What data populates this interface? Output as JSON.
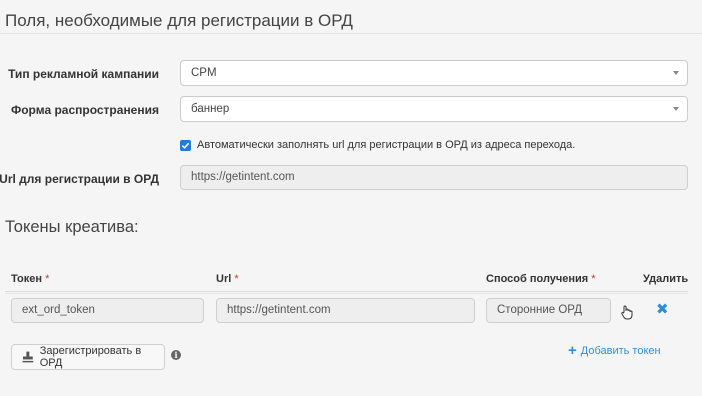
{
  "section": {
    "title": "Поля, необходимые для регистрации в ОРД"
  },
  "fields": {
    "campaign_type": {
      "label": "Тип рекламной кампании",
      "value": "CPM"
    },
    "distribution_form": {
      "label": "Форма распространения",
      "value": "баннер"
    },
    "auto_url": {
      "label": "Автоматически заполнять url для регистрации в ОРД из адреса перехода.",
      "checked": true
    },
    "ord_url": {
      "label": "Url для регистрации в ОРД",
      "value": "https://getintent.com"
    }
  },
  "tokens": {
    "title": "Токены креатива:",
    "columns": {
      "token": "Токен",
      "url": "Url",
      "method": "Способ получения",
      "delete": "Удалить",
      "required_mark": "*"
    },
    "rows": [
      {
        "token": "ext_ord_token",
        "url": "https://getintent.com",
        "method": "Сторонние ОРД"
      }
    ],
    "register_button": "Зарегистрировать в ОРД",
    "add_token": "Добавить токен"
  },
  "colors": {
    "accent": "#1e7be0",
    "link": "#2f8fdf",
    "required": "#c0392b"
  }
}
